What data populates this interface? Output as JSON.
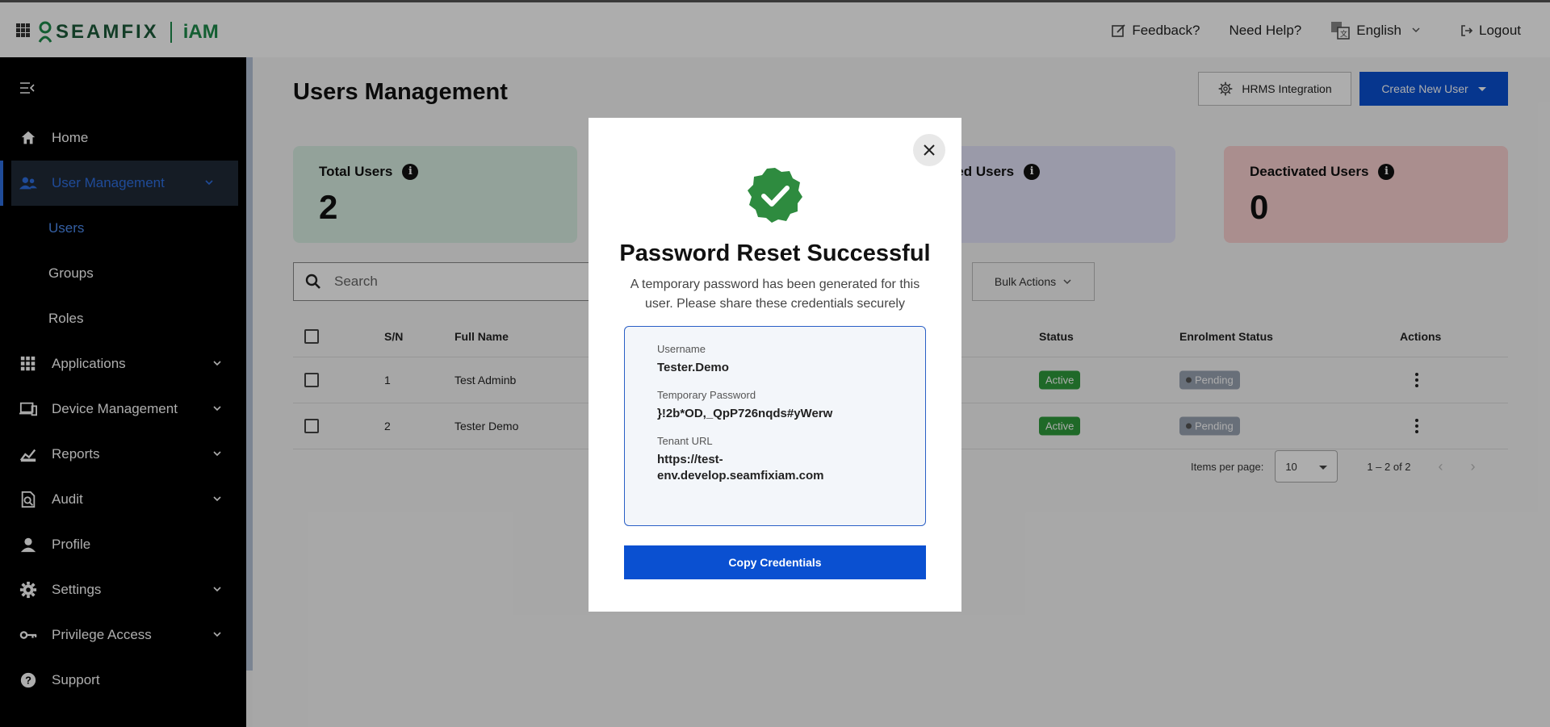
{
  "app": {
    "brand": "SEAMFIX",
    "product": "iAM"
  },
  "topbar": {
    "feedback": "Feedback?",
    "help": "Need Help?",
    "language": "English",
    "logout": "Logout"
  },
  "sidebar": {
    "items": [
      {
        "label": "Home"
      },
      {
        "label": "User Management"
      },
      {
        "label": "Users"
      },
      {
        "label": "Groups"
      },
      {
        "label": "Roles"
      },
      {
        "label": "Applications"
      },
      {
        "label": "Device Management"
      },
      {
        "label": "Reports"
      },
      {
        "label": "Audit"
      },
      {
        "label": "Profile"
      },
      {
        "label": "Settings"
      },
      {
        "label": "Privilege Access"
      },
      {
        "label": "Support"
      }
    ]
  },
  "main": {
    "title": "Users Management",
    "hrms_button": "HRMS Integration",
    "create_button": "Create New User",
    "cards": [
      {
        "label": "Total Users",
        "value": "2"
      },
      {
        "label": "enrolled Users",
        "value": ""
      },
      {
        "label": "Deactivated Users",
        "value": "0"
      }
    ],
    "search_placeholder": "Search",
    "bulk_actions": "Bulk Actions",
    "table": {
      "headers": {
        "sn": "S/N",
        "name": "Full Name",
        "status": "Status",
        "enrolment": "Enrolment Status",
        "actions": "Actions"
      },
      "rows": [
        {
          "sn": "1",
          "name": "Test Adminb",
          "status": "Active",
          "enrolment": "Pending"
        },
        {
          "sn": "2",
          "name": "Tester Demo",
          "status": "Active",
          "enrolment": "Pending"
        }
      ]
    },
    "pager": {
      "label": "Items per page:",
      "per_page": "10",
      "range": "1 – 2 of 2"
    }
  },
  "modal": {
    "title": "Password Reset Successful",
    "subtitle": "A temporary password has been generated for this user. Please share these credentials securely",
    "username_label": "Username",
    "username": "Tester.Demo",
    "password_label": "Temporary Password",
    "password": "}!2b*OD,_QpP726nqds#yWerw",
    "tenant_label": "Tenant URL",
    "tenant_url": "https://test-env.develop.seamfixiam.com",
    "copy_button": "Copy Credentials"
  },
  "colors": {
    "primary": "#0a50d1",
    "success": "#2e9b3c",
    "brand_green": "#1c8b4a",
    "sidebar_bg": "#000000"
  }
}
